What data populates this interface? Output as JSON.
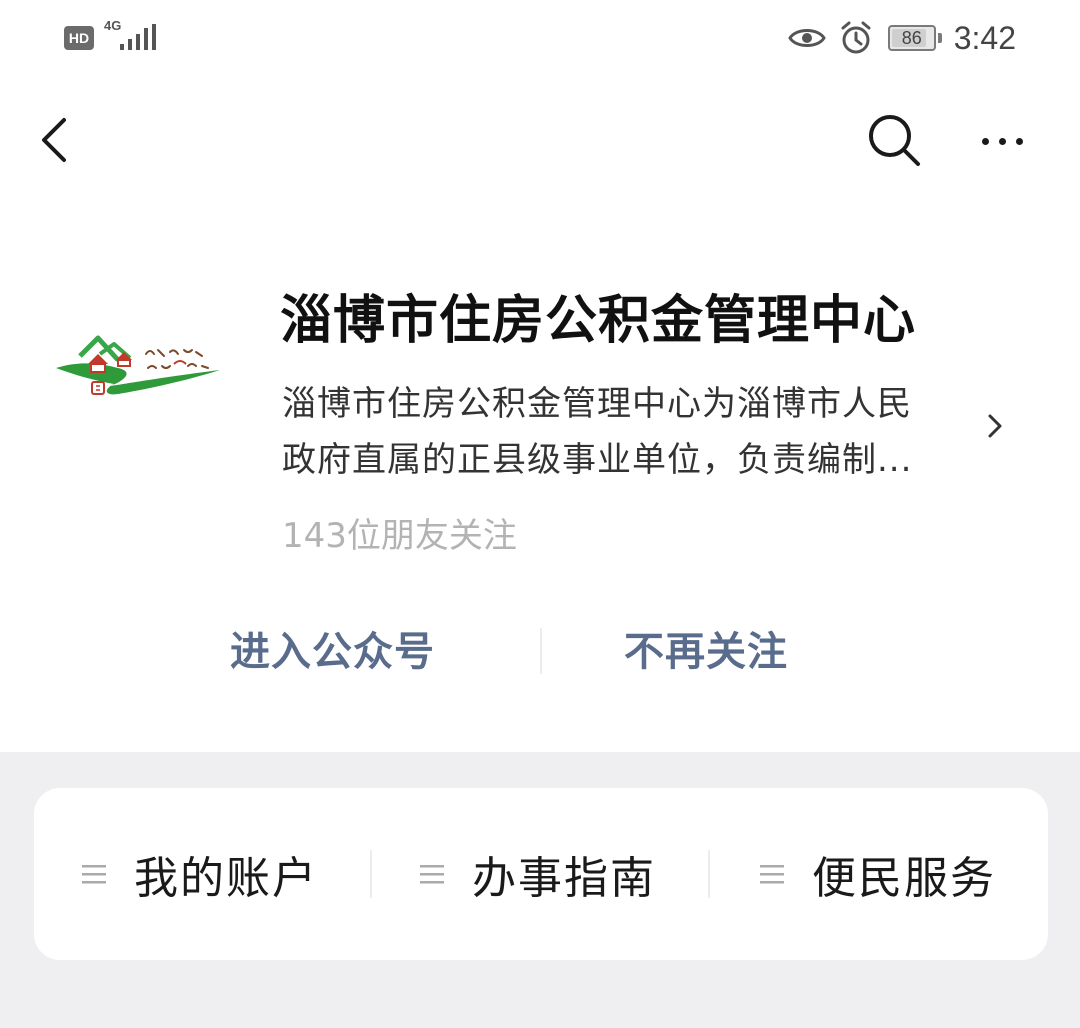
{
  "status_bar": {
    "hd_label": "HD",
    "network_label": "4G",
    "battery_percent": 86,
    "battery_label": "86",
    "time": "3:42",
    "icons": [
      "eye-icon",
      "alarm-icon",
      "battery-icon",
      "signal-icon"
    ]
  },
  "nav": {
    "icons": [
      "back-arrow-icon",
      "search-icon",
      "more-icon"
    ]
  },
  "account": {
    "name": "淄博市住房公积金管理中心",
    "description_line1": "淄博市住房公积金管理中心为淄博市人民",
    "description_line2": "政府直属的正县级事业单位，负责编制...",
    "followers": "143位朋友关注",
    "logo_icon": "housing-fund-logo"
  },
  "actions": {
    "enter": "进入公众号",
    "unfollow": "不再关注"
  },
  "menu": {
    "items": [
      {
        "label": "我的账户",
        "icon": "menu-lines-icon"
      },
      {
        "label": "办事指南",
        "icon": "menu-lines-icon"
      },
      {
        "label": "便民服务",
        "icon": "menu-lines-icon"
      }
    ]
  },
  "colors": {
    "link": "#5a6c8c",
    "background": "#efeff1",
    "card": "#ffffff",
    "muted_text": "#b3b3b3",
    "logo_green": "#2f9a3a",
    "logo_red": "#c0392b"
  }
}
